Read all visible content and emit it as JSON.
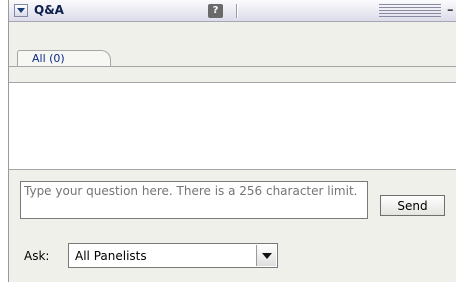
{
  "panel": {
    "title": "Q&A",
    "help_icon_glyph": "?",
    "minimize_glyph": "–"
  },
  "tabs": [
    {
      "label": "All (0)"
    }
  ],
  "composer": {
    "placeholder": "Type your question here. There is a 256 character limit.",
    "send_label": "Send",
    "ask_label": "Ask:",
    "ask_value": "All Panelists"
  },
  "icons": {
    "collapse": "triangle-down-icon",
    "help": "question-mark-icon",
    "dropdown": "chevron-down-icon"
  }
}
